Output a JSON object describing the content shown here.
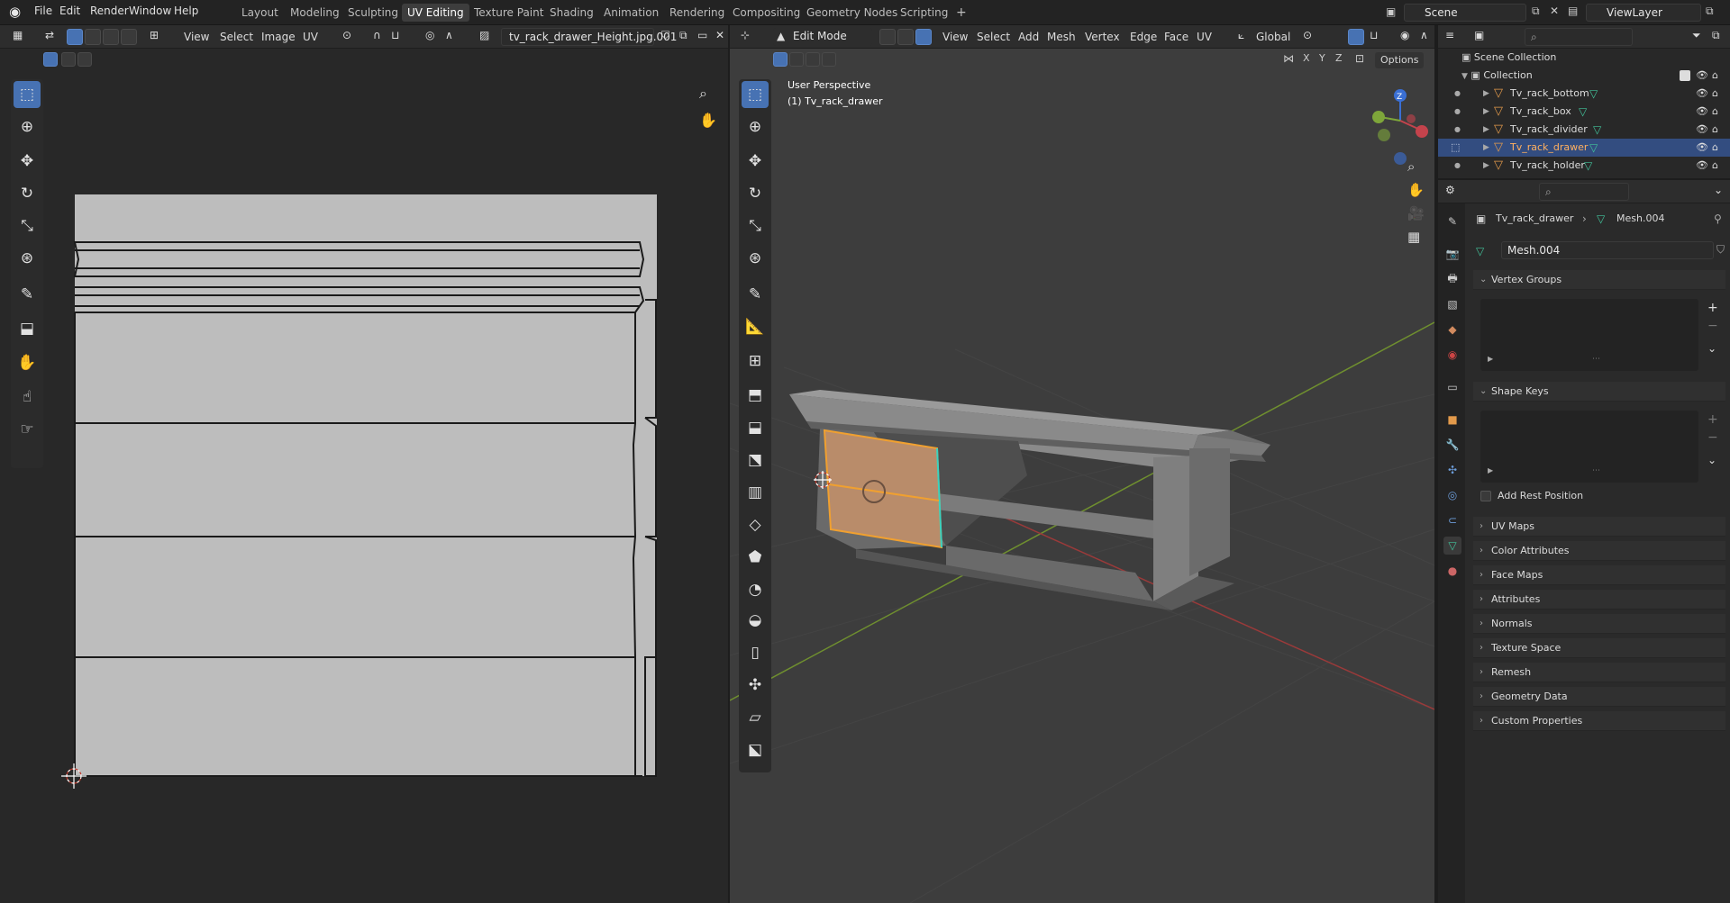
{
  "topbar": {
    "menus": [
      "File",
      "Edit",
      "Render",
      "Window",
      "Help"
    ],
    "workspaces": [
      "Layout",
      "Modeling",
      "Sculpting",
      "UV Editing",
      "Texture Paint",
      "Shading",
      "Animation",
      "Rendering",
      "Compositing",
      "Geometry Nodes",
      "Scripting"
    ],
    "active_workspace": "UV Editing",
    "add_tab": "+",
    "scene_name": "Scene",
    "view_layer": "ViewLayer"
  },
  "uv_editor": {
    "menus": [
      "View",
      "Select",
      "Image",
      "UV"
    ],
    "image_name": "tv_rack_drawer_Height.jpg.001"
  },
  "viewport": {
    "mode": "Edit Mode",
    "menus": [
      "View",
      "Select",
      "Add",
      "Mesh",
      "Vertex",
      "Edge",
      "Face",
      "UV"
    ],
    "transform_orientation": "Global",
    "axis_x": "X",
    "axis_y": "Y",
    "axis_z": "Z",
    "options_label": "Options",
    "overlay_line1": "User Perspective",
    "overlay_line2": "(1) Tv_rack_drawer",
    "gizmo_z": "Z"
  },
  "outliner": {
    "scene_collection": "Scene Collection",
    "collection": "Collection",
    "objects": [
      {
        "name": "Tv_rack_bottom",
        "selected": false
      },
      {
        "name": "Tv_rack_box",
        "selected": false
      },
      {
        "name": "Tv_rack_divider",
        "selected": false
      },
      {
        "name": "Tv_rack_drawer",
        "selected": true
      },
      {
        "name": "Tv_rack_holder",
        "selected": false
      }
    ]
  },
  "properties": {
    "breadcrumb_object": "Tv_rack_drawer",
    "breadcrumb_mesh": "Mesh.004",
    "mesh_name": "Mesh.004",
    "vertex_groups": "Vertex Groups",
    "shape_keys": "Shape Keys",
    "add_rest_position": "Add Rest Position",
    "panels": [
      "UV Maps",
      "Color Attributes",
      "Face Maps",
      "Attributes",
      "Normals",
      "Texture Space",
      "Remesh",
      "Geometry Data",
      "Custom Properties"
    ]
  },
  "colors": {
    "accent": "#4772b3",
    "selection": "#334d80",
    "mesh_icon": "#e39a4b",
    "data_icon": "#42c29a",
    "x_axis": "#c4434c",
    "y_axis": "#7ea63a",
    "z_axis": "#3a6fd4"
  }
}
